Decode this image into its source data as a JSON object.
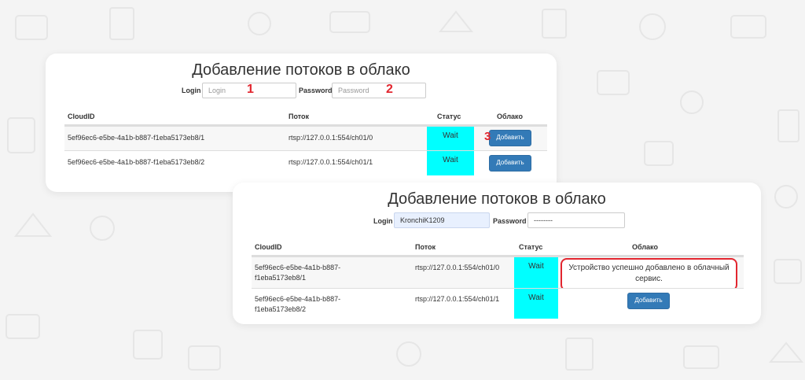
{
  "colors": {
    "page_bg": "#f4f4f4",
    "accent_button": "#337ab7",
    "status_wait": "#00ffff",
    "annotation_red": "#e2262f"
  },
  "panel1": {
    "title": "Добавление потоков в облако",
    "login_label": "Login",
    "login_placeholder": "Login",
    "password_label": "Password",
    "password_placeholder": "Password",
    "marker_login": "1",
    "marker_password": "2",
    "marker_button": "3",
    "columns": {
      "cloudid": "CloudID",
      "stream": "Поток",
      "status": "Статус",
      "cloud": "Облако"
    },
    "rows": [
      {
        "cloudid": "5ef96ec6-e5be-4a1b-b887-f1eba5173eb8/1",
        "stream": "rtsp://127.0.0.1:554/ch01/0",
        "status": "Wait",
        "action": "Добавить"
      },
      {
        "cloudid": "5ef96ec6-e5be-4a1b-b887-f1eba5173eb8/2",
        "stream": "rtsp://127.0.0.1:554/ch01/1",
        "status": "Wait",
        "action": "Добавить"
      }
    ]
  },
  "panel2": {
    "title": "Добавление потоков в облако",
    "login_label": "Login",
    "login_value": "KronchiK1209",
    "password_label": "Password",
    "password_value": "--------",
    "columns": {
      "cloudid": "CloudID",
      "stream": "Поток",
      "status": "Статус",
      "cloud": "Облако"
    },
    "rows": [
      {
        "cloudid_line1": "5ef96ec6-e5be-4a1b-b887-",
        "cloudid_line2": "f1eba5173eb8/1",
        "stream": "rtsp://127.0.0.1:554/ch01/0",
        "status": "Wait",
        "message_line1": "Устройство успешно добавлено в облачный",
        "message_line2": "сервис."
      },
      {
        "cloudid_line1": "5ef96ec6-e5be-4a1b-b887-",
        "cloudid_line2": "f1eba5173eb8/2",
        "stream": "rtsp://127.0.0.1:554/ch01/1",
        "status": "Wait",
        "action": "Добавить"
      }
    ]
  }
}
